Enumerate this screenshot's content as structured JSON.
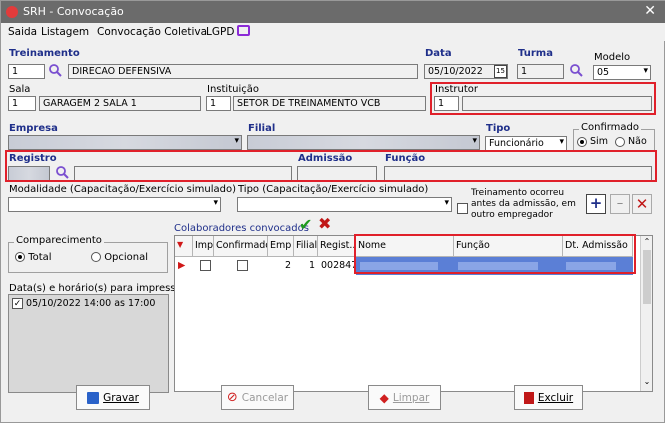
{
  "window": {
    "title": "SRH - Convocação",
    "close": "✕"
  },
  "menu": [
    "Saida",
    "Listagem",
    "Convocação Coletiva",
    "LGPD"
  ],
  "treinamento": {
    "label": "Treinamento",
    "code": "1",
    "name": "DIRECAO DEFENSIVA"
  },
  "data": {
    "label": "Data",
    "value": "05/10/2022",
    "cal": "15"
  },
  "turma": {
    "label": "Turma",
    "value": "1"
  },
  "modelo": {
    "label": "Modelo",
    "value": "05"
  },
  "sala": {
    "label": "Sala",
    "code": "1",
    "name": "GARAGEM 2 SALA 1"
  },
  "instituicao": {
    "label": "Instituição",
    "code": "1",
    "name": "SETOR DE TREINAMENTO VCB"
  },
  "instrutor": {
    "label": "Instrutor",
    "code": "1"
  },
  "empresa": {
    "label": "Empresa"
  },
  "filial": {
    "label": "Filial"
  },
  "tipo": {
    "label": "Tipo",
    "value": "Funcionário"
  },
  "confirmado": {
    "label": "Confirmado",
    "sim": "Sim",
    "nao": "Não"
  },
  "registro": {
    "label": "Registro"
  },
  "admissao": {
    "label": "Admissão"
  },
  "funcao": {
    "label": "Função"
  },
  "modalidade": {
    "label": "Modalidade (Capacitação/Exercício simulado)"
  },
  "tipo_cap": {
    "label": "Tipo (Capacitação/Exercício simulado)"
  },
  "treinamento_antes": "Treinamento ocorreu antes da admissão, em outro empregador",
  "comparecimento": {
    "label": "Comparecimento",
    "total": "Total",
    "opcional": "Opcional"
  },
  "datas_label": "Data(s) e horário(s) para impressão",
  "datas": [
    "05/10/2022 14:00 as 17:00"
  ],
  "colab_label": "Colaboradores convocados",
  "grid": {
    "headers": [
      "Imp.",
      "Confirmado",
      "Emp",
      "Filial",
      "Regist...",
      "Nome",
      "Função",
      "Dt. Admissão"
    ],
    "row": {
      "emp": "2",
      "filial": "1",
      "registro": "002847"
    }
  },
  "buttons": {
    "gravar": "Gravar",
    "cancelar": "Cancelar",
    "limpar": "Limpar",
    "excluir": "Excluir"
  },
  "colors": {
    "highlight": "#e0202a",
    "label_blue": "#1f2f8a",
    "row_sel": "#5b7fd6"
  }
}
